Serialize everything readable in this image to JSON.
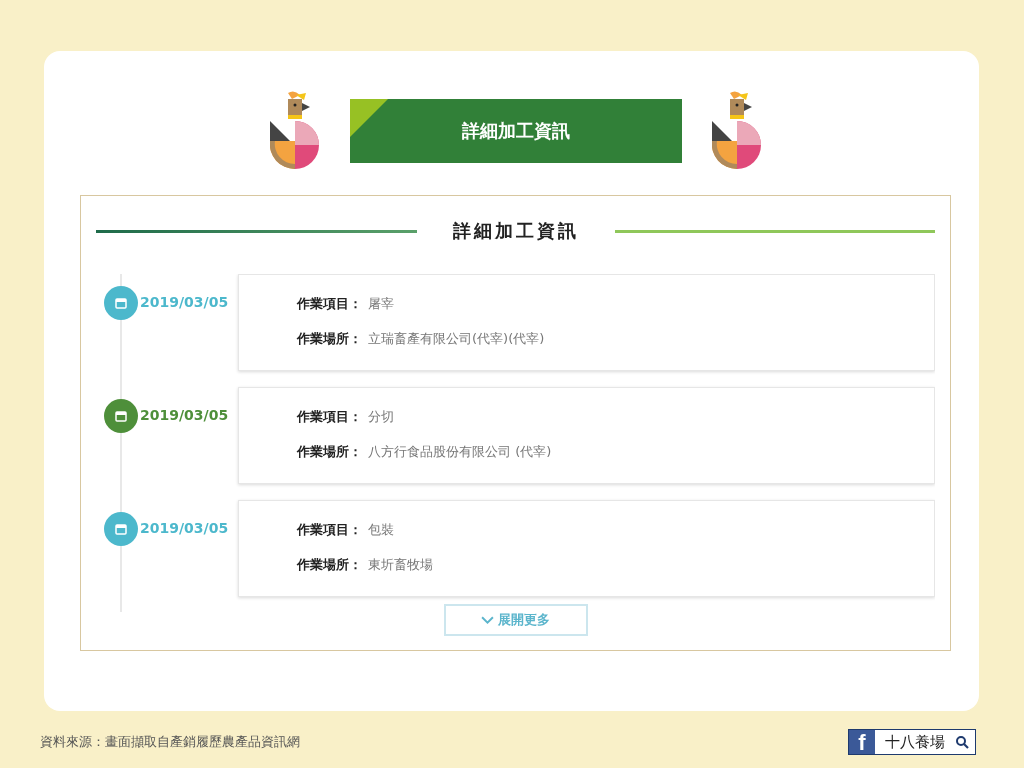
{
  "banner": {
    "title": "詳細加工資訊"
  },
  "section": {
    "title": "詳細加工資訊"
  },
  "entries": [
    {
      "date": "2019/03/05",
      "color": "#4cb8cc",
      "fields": [
        {
          "label": "作業項目：",
          "value": "屠宰"
        },
        {
          "label": "作業場所：",
          "value": "立瑞畜產有限公司(代宰)(代宰)"
        }
      ]
    },
    {
      "date": "2019/03/05",
      "color": "#4e8f3a",
      "fields": [
        {
          "label": "作業項目：",
          "value": "分切"
        },
        {
          "label": "作業場所：",
          "value": "八方行食品股份有限公司 (代宰)"
        }
      ]
    },
    {
      "date": "2019/03/05",
      "color": "#4cb8cc",
      "fields": [
        {
          "label": "作業項目：",
          "value": "包裝"
        },
        {
          "label": "作業場所：",
          "value": "東圻畜牧場"
        }
      ]
    }
  ],
  "more_button": "展開更多",
  "footer": {
    "source": "資料來源：畫面擷取自產銷履歷農產品資訊網",
    "fb_logo": "f",
    "search_text": "十八養場"
  }
}
